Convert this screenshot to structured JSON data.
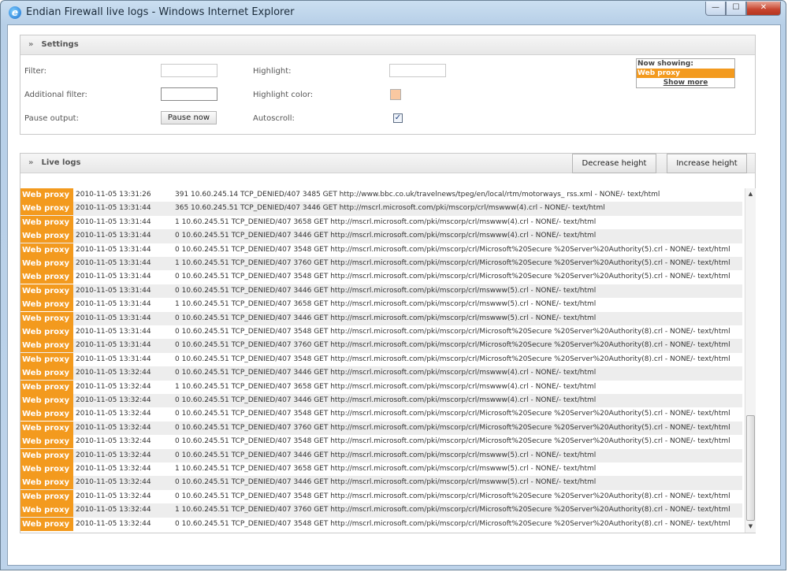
{
  "window": {
    "title": "Endian Firewall live logs - Windows Internet Explorer",
    "buttons": {
      "minimize": "—",
      "maximize": "☐",
      "close": "✕"
    }
  },
  "settings": {
    "header": "Settings",
    "filter_label": "Filter:",
    "filter_value": "",
    "additional_filter_label": "Additional filter:",
    "additional_filter_value": "",
    "pause_label": "Pause output:",
    "pause_button": "Pause now",
    "highlight_label": "Highlight:",
    "highlight_value": "",
    "highlight_color_label": "Highlight color:",
    "highlight_color": "#f9c8a1",
    "autoscroll_label": "Autoscroll:",
    "autoscroll_checked": true,
    "now_showing_header": "Now showing:",
    "now_showing_item": "Web proxy",
    "show_more": "Show more"
  },
  "live": {
    "header": "Live logs",
    "decrease_button": "Decrease height",
    "increase_button": "Increase height"
  },
  "colors": {
    "accent": "#f39a1e"
  },
  "logs": [
    {
      "tag": "Web proxy",
      "ts": "2010-11-05 13:31:26",
      "msg": "391 10.60.245.14 TCP_DENIED/407 3485 GET http://www.bbc.co.uk/travelnews/tpeg/en/local/rtm/motorways_ rss.xml  - NONE/- text/html"
    },
    {
      "tag": "Web proxy",
      "ts": "2010-11-05 13:31:44",
      "msg": "365 10.60.245.51 TCP_DENIED/407 3446 GET http://mscrl.microsoft.com/pki/mscorp/crl/mswww(4).crl - NONE/- text/html"
    },
    {
      "tag": "Web proxy",
      "ts": "2010-11-05 13:31:44",
      "msg": "1 10.60.245.51 TCP_DENIED/407 3658 GET http://mscrl.microsoft.com/pki/mscorp/crl/mswww(4).crl - NONE/- text/html"
    },
    {
      "tag": "Web proxy",
      "ts": "2010-11-05 13:31:44",
      "msg": "0 10.60.245.51 TCP_DENIED/407 3446 GET http://mscrl.microsoft.com/pki/mscorp/crl/mswww(4).crl - NONE/- text/html"
    },
    {
      "tag": "Web proxy",
      "ts": "2010-11-05 13:31:44",
      "msg": "0 10.60.245.51 TCP_DENIED/407 3548 GET http://mscrl.microsoft.com/pki/mscorp/crl/Microsoft%20Secure %20Server%20Authority(5).crl  - NONE/- text/html"
    },
    {
      "tag": "Web proxy",
      "ts": "2010-11-05 13:31:44",
      "msg": "1 10.60.245.51 TCP_DENIED/407 3760 GET http://mscrl.microsoft.com/pki/mscorp/crl/Microsoft%20Secure %20Server%20Authority(5).crl  - NONE/- text/html"
    },
    {
      "tag": "Web proxy",
      "ts": "2010-11-05 13:31:44",
      "msg": "0 10.60.245.51 TCP_DENIED/407 3548 GET http://mscrl.microsoft.com/pki/mscorp/crl/Microsoft%20Secure %20Server%20Authority(5).crl  - NONE/- text/html"
    },
    {
      "tag": "Web proxy",
      "ts": "2010-11-05 13:31:44",
      "msg": "0 10.60.245.51 TCP_DENIED/407 3446 GET http://mscrl.microsoft.com/pki/mscorp/crl/mswww(5).crl - NONE/- text/html"
    },
    {
      "tag": "Web proxy",
      "ts": "2010-11-05 13:31:44",
      "msg": "1 10.60.245.51 TCP_DENIED/407 3658 GET http://mscrl.microsoft.com/pki/mscorp/crl/mswww(5).crl - NONE/- text/html"
    },
    {
      "tag": "Web proxy",
      "ts": "2010-11-05 13:31:44",
      "msg": "0 10.60.245.51 TCP_DENIED/407 3446 GET http://mscrl.microsoft.com/pki/mscorp/crl/mswww(5).crl - NONE/- text/html"
    },
    {
      "tag": "Web proxy",
      "ts": "2010-11-05 13:31:44",
      "msg": "0 10.60.245.51 TCP_DENIED/407 3548 GET http://mscrl.microsoft.com/pki/mscorp/crl/Microsoft%20Secure %20Server%20Authority(8).crl  - NONE/- text/html"
    },
    {
      "tag": "Web proxy",
      "ts": "2010-11-05 13:31:44",
      "msg": "0 10.60.245.51 TCP_DENIED/407 3760 GET http://mscrl.microsoft.com/pki/mscorp/crl/Microsoft%20Secure %20Server%20Authority(8).crl  - NONE/- text/html"
    },
    {
      "tag": "Web proxy",
      "ts": "2010-11-05 13:31:44",
      "msg": "0 10.60.245.51 TCP_DENIED/407 3548 GET http://mscrl.microsoft.com/pki/mscorp/crl/Microsoft%20Secure %20Server%20Authority(8).crl  - NONE/- text/html"
    },
    {
      "tag": "Web proxy",
      "ts": "2010-11-05 13:32:44",
      "msg": "0 10.60.245.51 TCP_DENIED/407 3446 GET http://mscrl.microsoft.com/pki/mscorp/crl/mswww(4).crl - NONE/- text/html"
    },
    {
      "tag": "Web proxy",
      "ts": "2010-11-05 13:32:44",
      "msg": "1 10.60.245.51 TCP_DENIED/407 3658 GET http://mscrl.microsoft.com/pki/mscorp/crl/mswww(4).crl - NONE/- text/html"
    },
    {
      "tag": "Web proxy",
      "ts": "2010-11-05 13:32:44",
      "msg": "0 10.60.245.51 TCP_DENIED/407 3446 GET http://mscrl.microsoft.com/pki/mscorp/crl/mswww(4).crl - NONE/- text/html"
    },
    {
      "tag": "Web proxy",
      "ts": "2010-11-05 13:32:44",
      "msg": "0 10.60.245.51 TCP_DENIED/407 3548 GET http://mscrl.microsoft.com/pki/mscorp/crl/Microsoft%20Secure %20Server%20Authority(5).crl  - NONE/- text/html"
    },
    {
      "tag": "Web proxy",
      "ts": "2010-11-05 13:32:44",
      "msg": "0 10.60.245.51 TCP_DENIED/407 3760 GET http://mscrl.microsoft.com/pki/mscorp/crl/Microsoft%20Secure %20Server%20Authority(5).crl  - NONE/- text/html"
    },
    {
      "tag": "Web proxy",
      "ts": "2010-11-05 13:32:44",
      "msg": "0 10.60.245.51 TCP_DENIED/407 3548 GET http://mscrl.microsoft.com/pki/mscorp/crl/Microsoft%20Secure %20Server%20Authority(5).crl  - NONE/- text/html"
    },
    {
      "tag": "Web proxy",
      "ts": "2010-11-05 13:32:44",
      "msg": "0 10.60.245.51 TCP_DENIED/407 3446 GET http://mscrl.microsoft.com/pki/mscorp/crl/mswww(5).crl - NONE/- text/html"
    },
    {
      "tag": "Web proxy",
      "ts": "2010-11-05 13:32:44",
      "msg": "1 10.60.245.51 TCP_DENIED/407 3658 GET http://mscrl.microsoft.com/pki/mscorp/crl/mswww(5).crl - NONE/- text/html"
    },
    {
      "tag": "Web proxy",
      "ts": "2010-11-05 13:32:44",
      "msg": "0 10.60.245.51 TCP_DENIED/407 3446 GET http://mscrl.microsoft.com/pki/mscorp/crl/mswww(5).crl - NONE/- text/html"
    },
    {
      "tag": "Web proxy",
      "ts": "2010-11-05 13:32:44",
      "msg": "0 10.60.245.51 TCP_DENIED/407 3548 GET http://mscrl.microsoft.com/pki/mscorp/crl/Microsoft%20Secure %20Server%20Authority(8).crl  - NONE/- text/html"
    },
    {
      "tag": "Web proxy",
      "ts": "2010-11-05 13:32:44",
      "msg": "1 10.60.245.51 TCP_DENIED/407 3760 GET http://mscrl.microsoft.com/pki/mscorp/crl/Microsoft%20Secure %20Server%20Authority(8).crl  - NONE/- text/html"
    },
    {
      "tag": "Web proxy",
      "ts": "2010-11-05 13:32:44",
      "msg": "0 10.60.245.51 TCP_DENIED/407 3548 GET http://mscrl.microsoft.com/pki/mscorp/crl/Microsoft%20Secure %20Server%20Authority(8).crl  - NONE/- text/html"
    }
  ]
}
